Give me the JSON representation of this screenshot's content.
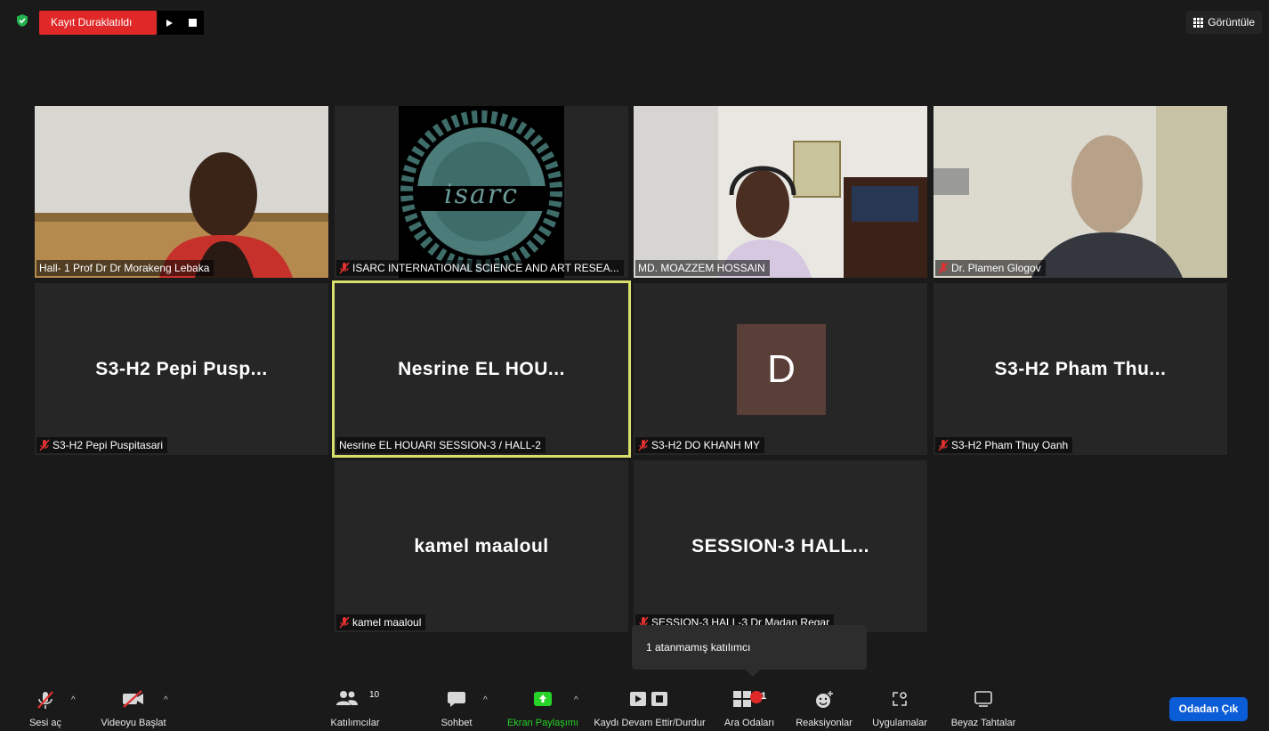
{
  "topbar": {
    "recording_status": "Kayıt Duraklatıldı",
    "view_label": "Görüntüle"
  },
  "tiles": [
    {
      "id": "t1",
      "label": "Hall- 1 Prof Dr Dr Morakeng Lebaka",
      "muted": false,
      "type": "video"
    },
    {
      "id": "t2",
      "label": "ISARC INTERNATIONAL SCIENCE AND ART RESEA...",
      "muted": true,
      "type": "logo",
      "logo_text": "isarc",
      "logo_ring": "NATIONAL SCIENCE AND ART RESEARCH CE"
    },
    {
      "id": "t3",
      "label": "MD. MOAZZEM HOSSAIN",
      "muted": false,
      "type": "video"
    },
    {
      "id": "t4",
      "label": "Dr. Plamen Glogov",
      "muted": true,
      "type": "video"
    },
    {
      "id": "t5",
      "label": "S3-H2 Pepi Puspitasari",
      "name": "S3-H2 Pepi Pusp...",
      "muted": true,
      "type": "name"
    },
    {
      "id": "t6",
      "label": "Nesrine EL HOUARI SESSION-3 / HALL-2",
      "name": "Nesrine EL HOU...",
      "muted": false,
      "type": "name",
      "speaking": true
    },
    {
      "id": "t7",
      "label": "S3-H2 DO KHANH MY",
      "avatar": "D",
      "muted": true,
      "type": "avatar"
    },
    {
      "id": "t8",
      "label": "S3-H2 Pham Thuy Oanh",
      "name": "S3-H2 Pham Thu...",
      "muted": true,
      "type": "name"
    },
    {
      "id": "t9",
      "label": "kamel maaloul",
      "name": "kamel maaloul",
      "muted": true,
      "type": "name"
    },
    {
      "id": "t10",
      "label": "SESSION-3 HALL-3 Dr Madan Regar",
      "name": "SESSION-3  HALL...",
      "muted": true,
      "type": "name"
    }
  ],
  "tooltip": {
    "text": "1 atanmamış katılımcı"
  },
  "toolbar": {
    "audio": "Sesi aç",
    "video": "Videoyu Başlat",
    "participants": "Katılımcılar",
    "participants_count": "10",
    "chat": "Sohbet",
    "share": "Ekran Paylaşımı",
    "record": "Kaydı Devam Ettir/Durdur",
    "breakout": "Ara Odaları",
    "breakout_badge": "1",
    "reactions": "Reaksiyonlar",
    "apps": "Uygulamalar",
    "whiteboards": "Beyaz Tahtalar",
    "leave": "Odadan Çık"
  },
  "colors": {
    "record_red": "#e02828",
    "speaking_outline": "#d9df6b",
    "share_green": "#27d327",
    "leave_blue": "#0b5cd7",
    "avatar_bg": "#5a3e38"
  }
}
